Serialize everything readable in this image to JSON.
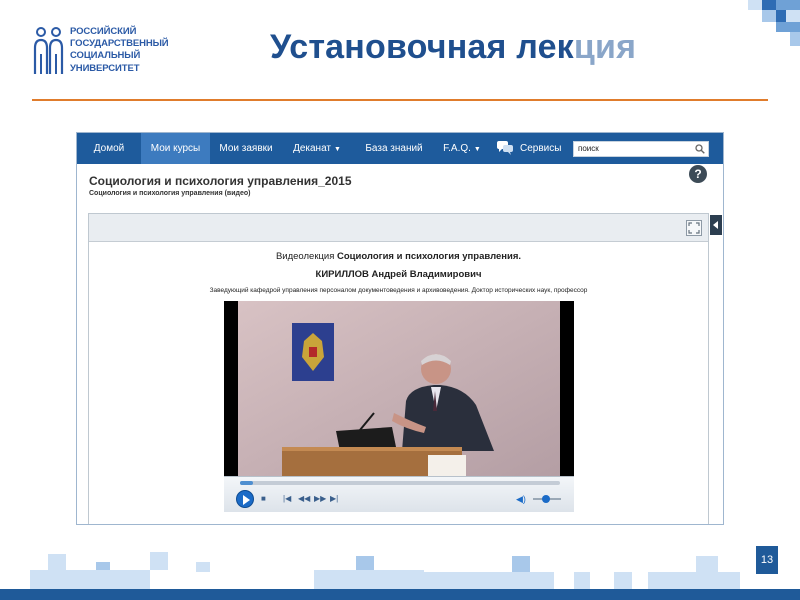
{
  "logo": {
    "lines": [
      "РОССИЙСКИЙ",
      "ГОСУДАРСТВЕННЫЙ",
      "СОЦИАЛЬНЫЙ",
      "УНИВЕРСИТЕТ"
    ]
  },
  "slide": {
    "title_main": "Установочная лек",
    "title_faded": "ция",
    "page_number": "13"
  },
  "nav": {
    "items": [
      "Домой",
      "Мои курсы",
      "Мои заявки",
      "Деканат",
      "База знаний",
      "F.A.Q.",
      "Сервисы"
    ],
    "active_index": 1,
    "search_value": "поиск"
  },
  "course": {
    "title": "Социология и психология управления_2015",
    "subtitle": "Социология и психология управления (видео)",
    "help_label": "?"
  },
  "lecture": {
    "prefix": "Видеолекция ",
    "name": "Социология и психология управления.",
    "lecturer": "КИРИЛЛОВ Андрей Владимирович",
    "position": "Заведующий кафедрой управления персоналом документоведения и архивоведения. Доктор исторических наук, профессор"
  },
  "player": {
    "progress": 0.04,
    "volume": 0.45
  },
  "colors": {
    "nav_bg": "#1e5b9c",
    "nav_active": "#3d7bbf",
    "accent_line": "#e07c2c",
    "title": "#1f4f8e"
  }
}
